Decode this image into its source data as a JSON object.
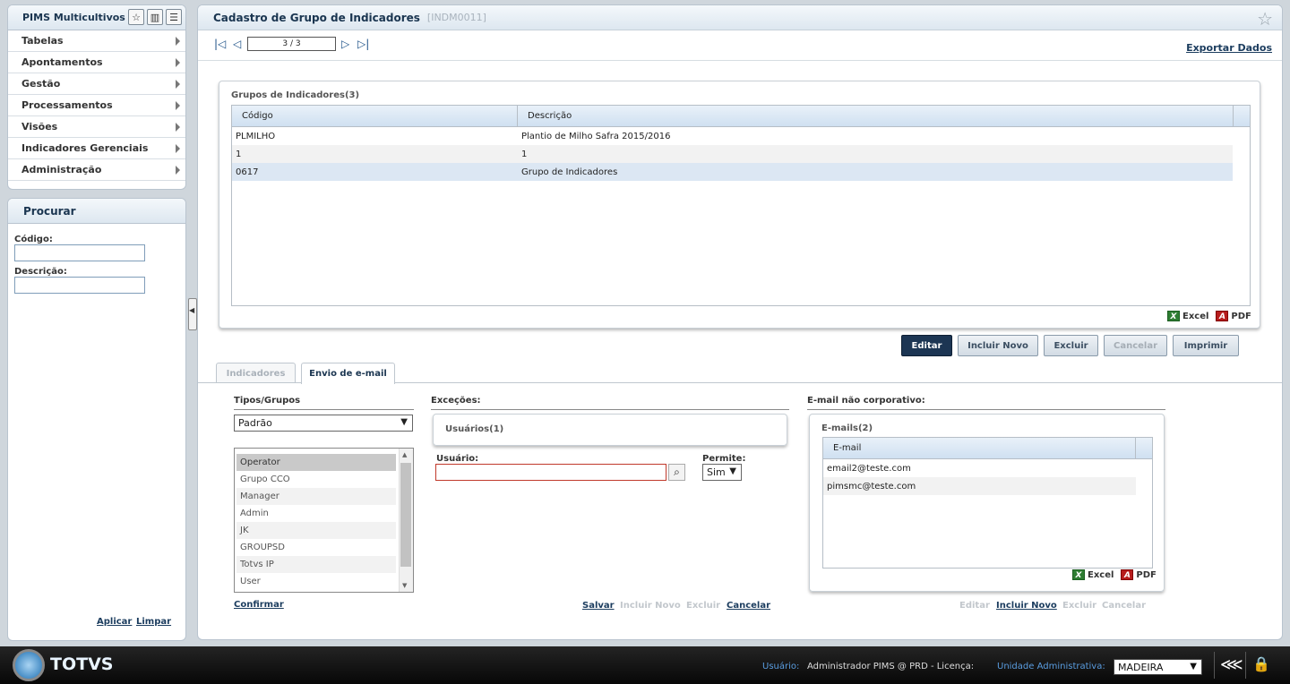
{
  "sidebar": {
    "app_title": "PIMS Multicultivos",
    "menu": [
      {
        "label": "Tabelas"
      },
      {
        "label": "Apontamentos"
      },
      {
        "label": "Gestão"
      },
      {
        "label": "Processamentos"
      },
      {
        "label": "Visões"
      },
      {
        "label": "Indicadores Gerenciais"
      },
      {
        "label": "Administração"
      }
    ]
  },
  "search_panel": {
    "title": "Procurar",
    "code_label": "Código:",
    "desc_label": "Descrição:",
    "apply": "Aplicar",
    "clear": "Limpar"
  },
  "header": {
    "title": "Cadastro de Grupo de Indicadores",
    "code": "[INDM0011]"
  },
  "toolbar": {
    "page_indicator": "3 / 3",
    "export": "Exportar Dados"
  },
  "groups": {
    "title": "Grupos de Indicadores(3)",
    "columns": [
      "Código",
      "Descrição"
    ],
    "rows": [
      {
        "code": "PLMILHO",
        "desc": "Plantio de Milho Safra 2015/2016"
      },
      {
        "code": "1",
        "desc": "1"
      },
      {
        "code": "0617",
        "desc": "Grupo de Indicadores"
      }
    ],
    "excel": "Excel",
    "pdf": "PDF"
  },
  "actions": {
    "edit": "Editar",
    "new": "Incluir Novo",
    "delete": "Excluir",
    "cancel": "Cancelar",
    "print": "Imprimir"
  },
  "tabs": {
    "indicators": "Indicadores",
    "email": "Envio de e-mail"
  },
  "types": {
    "title": "Tipos/Grupos",
    "selected": "Padrão",
    "items": [
      "Operator",
      "Grupo CCO",
      "Manager",
      "Admin",
      "JK",
      "GROUPSD",
      "Totvs IP",
      "User"
    ],
    "confirm": "Confirmar"
  },
  "exceptions": {
    "title": "Exceções:",
    "users_title": "Usuários(1)",
    "user_label": "Usuário:",
    "user_value": "",
    "allow_label": "Permite:",
    "allow_value": "Sim",
    "save": "Salvar",
    "new": "Incluir Novo",
    "delete": "Excluir",
    "cancel": "Cancelar"
  },
  "external_email": {
    "title": "E-mail não corporativo:",
    "list_title": "E-mails(2)",
    "column": "E-mail",
    "rows": [
      "email2@teste.com",
      "pimsmc@teste.com"
    ],
    "excel": "Excel",
    "pdf": "PDF",
    "edit": "Editar",
    "new": "Incluir Novo",
    "delete": "Excluir",
    "cancel": "Cancelar"
  },
  "footer": {
    "brand": "TOTVS",
    "user_label": "Usuário:",
    "user_value": "Administrador PIMS @ PRD - Licença:",
    "unit_label": "Unidade Administrativa:",
    "unit_value": "MADEIRA"
  },
  "icons": {
    "favorite": "star-icon",
    "chart": "bar-chart-icon",
    "list": "list-icon",
    "share": "share-icon",
    "lock": "lock-icon",
    "search": "magnifier-icon"
  }
}
